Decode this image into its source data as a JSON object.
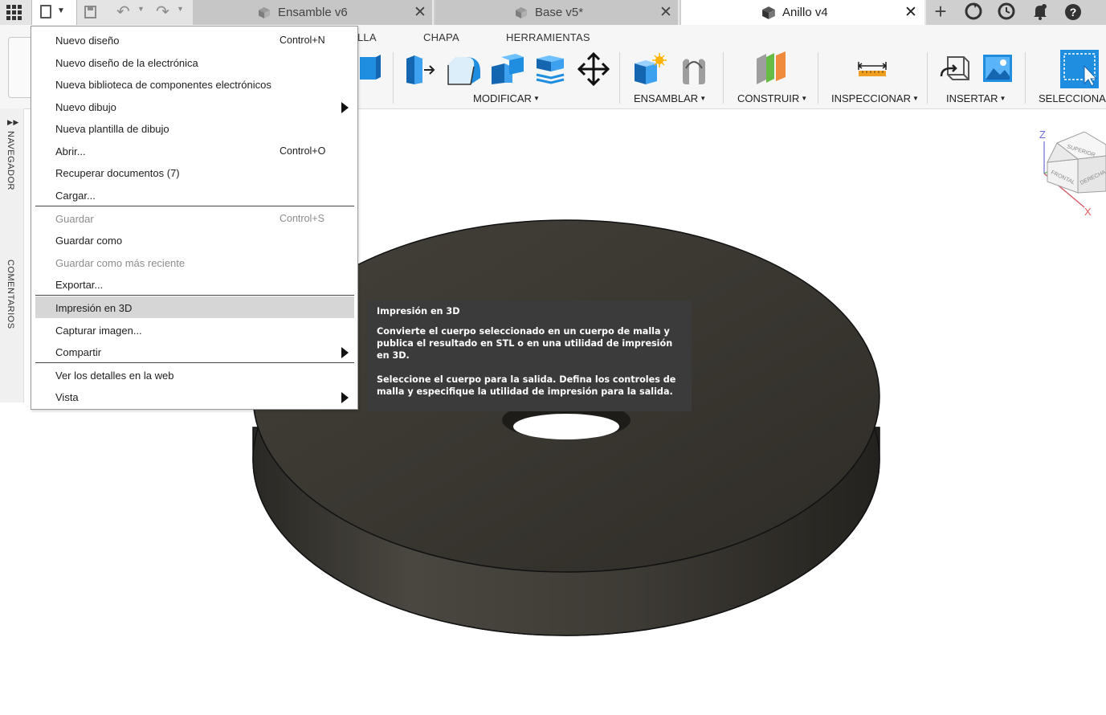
{
  "titlebar": {
    "tabs": [
      {
        "label": "Ensamble v6",
        "active": false
      },
      {
        "label": "Base v5*",
        "active": false
      },
      {
        "label": "Anillo v4",
        "active": true
      }
    ],
    "close_glyph": "✕",
    "icons": [
      "apps-grid-icon",
      "file-icon",
      "save-icon",
      "undo-icon",
      "redo-icon",
      "add-tab-icon",
      "sync-icon",
      "job-status-icon",
      "notifications-icon",
      "help-icon"
    ]
  },
  "ribbon": {
    "tabs": [
      "LLA",
      "CHAPA",
      "HERRAMIENTAS"
    ],
    "groups": {
      "modificar": "MODIFICAR",
      "ensamblar": "ENSAMBLAR",
      "construir": "CONSTRUIR",
      "inspeccionar": "INSPECCIONAR",
      "insertar": "INSERTAR",
      "seleccionar": "SELECCIONAR"
    },
    "dropdown_glyph": "▼"
  },
  "side_panel": {
    "navigator": "NAVEGADOR",
    "navigator_glyph": "▶▶",
    "comments": "COMENTARIOS"
  },
  "file_menu": {
    "items": [
      {
        "label": "Nuevo diseño",
        "shortcut": "Control+N"
      },
      {
        "label": "Nuevo diseño de la electrónica"
      },
      {
        "label": "Nueva biblioteca de componentes electrónicos"
      },
      {
        "label": "Nuevo dibujo",
        "submenu": true
      },
      {
        "label": "Nueva plantilla de dibujo"
      },
      {
        "label": "Abrir...",
        "shortcut": "Control+O"
      },
      {
        "label": "Recuperar documentos (7)"
      },
      {
        "label": "Cargar..."
      },
      {
        "label": "Guardar",
        "shortcut": "Control+S",
        "disabled": true
      },
      {
        "label": "Guardar como"
      },
      {
        "label": "Guardar como más reciente",
        "disabled": true
      },
      {
        "label": "Exportar..."
      },
      {
        "label": "Impresión en 3D",
        "highlighted": true
      },
      {
        "label": "Capturar imagen..."
      },
      {
        "label": "Compartir",
        "submenu": true
      },
      {
        "label": "Ver los detalles en la web"
      },
      {
        "label": "Vista",
        "submenu": true
      }
    ]
  },
  "tooltip": {
    "title": "Impresión en 3D",
    "paragraph1": "Convierte el cuerpo seleccionado en un cuerpo de malla y publica el resultado en STL o en una utilidad de impresión en 3D.",
    "paragraph2": "Seleccione el cuerpo para la salida. Defina los controles de malla y especifique la utilidad de impresión para la salida."
  },
  "viewcube": {
    "faces": {
      "top": "SUPERIOR",
      "front": "FRONTAL",
      "right": "DERECHA"
    },
    "axes": {
      "z": "Z",
      "x": "X"
    },
    "colors": {
      "z": "#6b6bd6",
      "x": "#e05a5a",
      "y": "#4caf50"
    }
  },
  "colors": {
    "accent_blue": "#1f8de0",
    "ring_body": "#3a3731",
    "tooltip_bg": "#3b3b3b",
    "menu_highlight": "#d6d6d6"
  }
}
